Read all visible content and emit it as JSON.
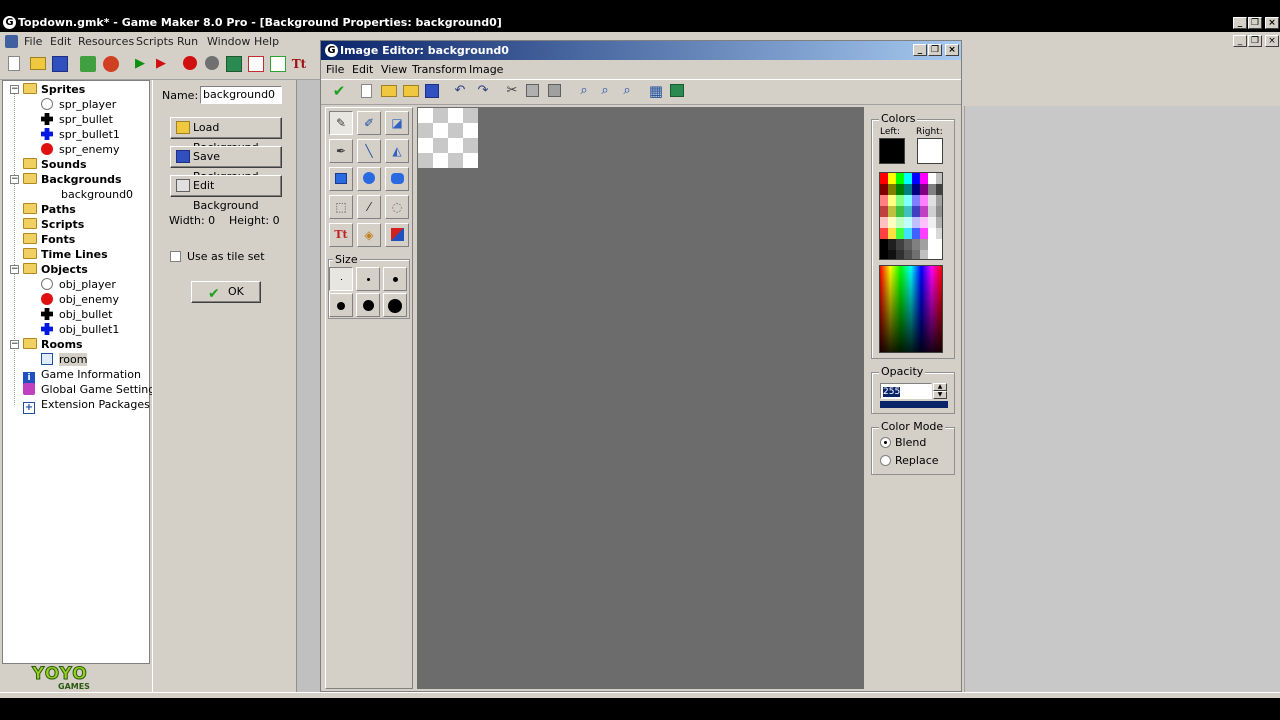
{
  "main_window": {
    "title": "Topdown.gmk* - Game Maker 8.0 Pro - [Background Properties: background0]",
    "logo_letter": "G",
    "menu": [
      "File",
      "Edit",
      "Resources",
      "Scripts",
      "Run",
      "Window",
      "Help"
    ]
  },
  "toolbar_icons": [
    "new-icon",
    "open-icon",
    "save-icon",
    "export-icon",
    "globe-icon",
    "run-icon",
    "run-debug-icon",
    "create-sprite-icon",
    "create-sound-icon",
    "create-background-icon",
    "create-path-icon",
    "create-script-icon",
    "create-font-icon"
  ],
  "toolbar_font_glyph": "Tt",
  "tree": {
    "folders": {
      "sprites": "Sprites",
      "sounds": "Sounds",
      "backgrounds": "Backgrounds",
      "paths": "Paths",
      "scripts": "Scripts",
      "fonts": "Fonts",
      "timelines": "Time Lines",
      "objects": "Objects",
      "rooms": "Rooms"
    },
    "sprites": [
      "spr_player",
      "spr_bullet",
      "spr_bullet1",
      "spr_enemy"
    ],
    "backgrounds": [
      "background0"
    ],
    "objects": [
      "obj_player",
      "obj_enemy",
      "obj_bullet",
      "obj_bullet1"
    ],
    "rooms": [
      "room"
    ],
    "extras": [
      "Game Information",
      "Global Game Settings",
      "Extension Packages"
    ],
    "expander_minus": "−",
    "info_glyph": "i",
    "ext_glyph": "+"
  },
  "logo": {
    "top": "YOYO",
    "bottom": "GAMES"
  },
  "bg_props": {
    "name_label": "Name:",
    "name_value": "background0",
    "load_label": "Load Background",
    "save_label": "Save Background",
    "edit_label": "Edit Background",
    "width_label": "Width: 0",
    "height_label": "Height: 0",
    "tileset_label": "Use as tile set",
    "ok_label": "OK"
  },
  "editor": {
    "title": "Image Editor: background0",
    "logo_letter": "G",
    "menu": [
      "File",
      "Edit",
      "View",
      "Transform",
      "Image"
    ],
    "size_legend": "Size",
    "colors_legend": "Colors",
    "left_label": "Left:",
    "right_label": "Right:",
    "left_color": "#000000",
    "right_color": "#ffffff",
    "opacity_legend": "Opacity",
    "opacity_value": "255",
    "color_mode_legend": "Color Mode",
    "blend_label": "Blend",
    "replace_label": "Replace",
    "selected_mode": "Blend",
    "text_tool_glyph": "Tt"
  },
  "window_buttons": {
    "minimize": "_",
    "restore": "❐",
    "close": "×"
  }
}
